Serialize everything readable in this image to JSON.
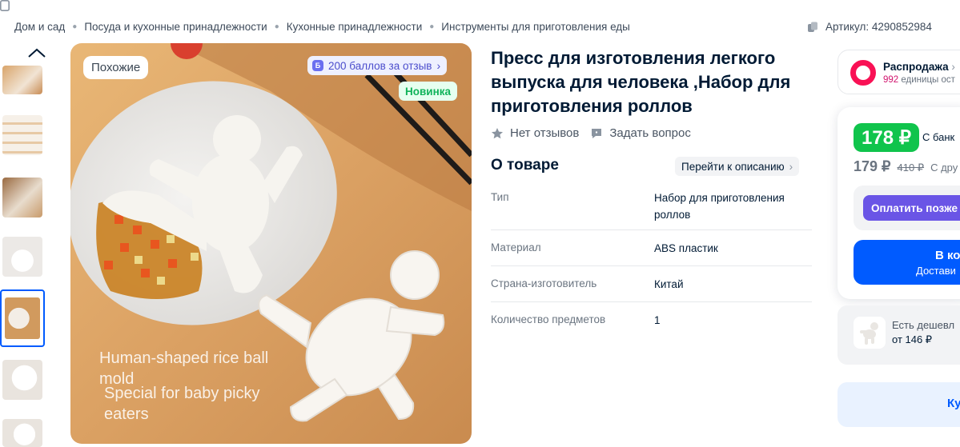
{
  "breadcrumbs": [
    "Дом и сад",
    "Посуда и кухонные принадлежности",
    "Кухонные принадлежности",
    "Инструменты для приготовления еды"
  ],
  "article": "Артикул: 4290852984",
  "gallery": {
    "badge_similar": "Похожие",
    "badge_points": "200 баллов за отзыв",
    "badge_points_icon": "Б",
    "badge_new": "Новинка",
    "overlay_line1": "Human-shaped rice ball",
    "overlay_line2": "mold",
    "overlay_line3": "Special for baby picky",
    "overlay_line4": "eaters"
  },
  "product": {
    "title": "Пресс для изготовления легкого выпуска для человека ,Набор для приготовления роллов",
    "no_reviews": "Нет отзывов",
    "ask_question": "Задать вопрос",
    "about_title": "О товаре",
    "goto_description": "Перейти к описанию",
    "specs": [
      {
        "key": "Тип",
        "value": "Набор для приготовления роллов"
      },
      {
        "key": "Материал",
        "value": "ABS пластик"
      },
      {
        "key": "Страна-изготовитель",
        "value": "Китай"
      },
      {
        "key": "Количество предметов",
        "value": "1"
      }
    ]
  },
  "side": {
    "sale_title": "Распродажа",
    "sale_count": "992",
    "sale_sub": "единицы ост",
    "price_card": "178 ₽",
    "price_card_label": "С банк",
    "price": "179 ₽",
    "price_old": "410 ₽",
    "price_label": "С дру",
    "pay_later": "Оплатить позже",
    "cart_label": "В ко",
    "delivery_label": "Достави",
    "cheaper_text": "Есть дешевл",
    "cheaper_price": "от 146 ₽",
    "extra_label": "Ку"
  },
  "colors": {
    "accent": "#005bff",
    "green_price": "#10c44c",
    "sale_pink": "#f91155",
    "pay_later": "#6a55e6"
  }
}
